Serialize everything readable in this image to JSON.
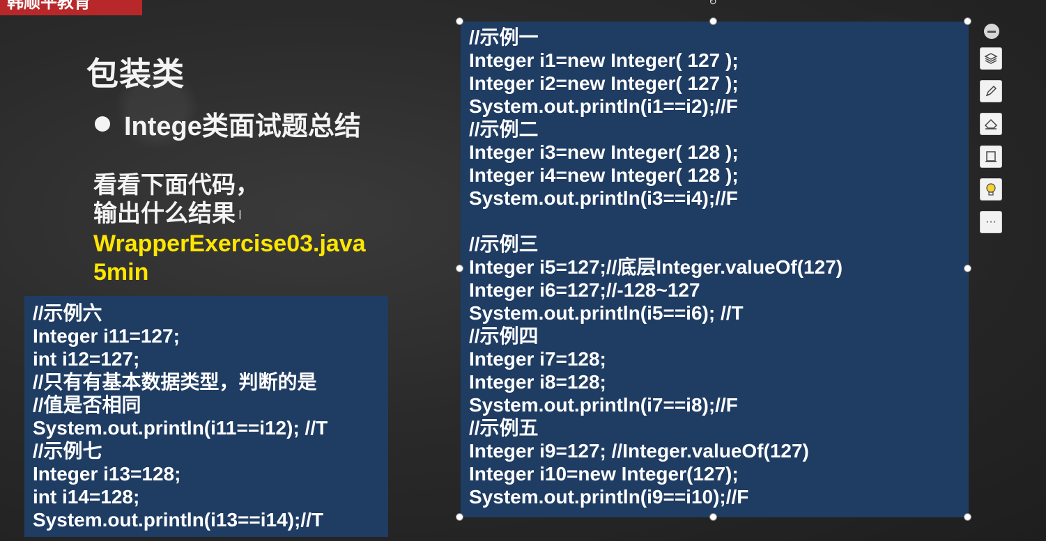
{
  "brand": {
    "label": "韩顺平教育"
  },
  "slide": {
    "title": "包装类",
    "bullet": "Intege类面试题总结",
    "prompt_lines": [
      "看看下面代码，",
      "输出什么结果"
    ],
    "file_name": "WrapperExercise03.java",
    "duration": "5min"
  },
  "code_left": {
    "lines": [
      "//示例六",
      "Integer i11=127;",
      "int i12=127;",
      "//只有有基本数据类型，判断的是",
      "//值是否相同",
      "System.out.println(i11==i12); //T",
      "//示例七",
      "Integer i13=128;",
      "int i14=128;",
      "System.out.println(i13==i14);//T"
    ]
  },
  "code_right": {
    "lines": [
      "//示例一",
      "Integer i1=new Integer( 127 );",
      "Integer i2=new Integer( 127 );",
      "System.out.println(i1==i2);//F",
      "//示例二",
      "Integer i3=new Integer( 128 );",
      "Integer i4=new Integer( 128 );",
      "System.out.println(i3==i4);//F",
      "",
      "//示例三",
      "Integer i5=127;//底层Integer.valueOf(127)",
      "Integer i6=127;//-128~127",
      "System.out.println(i5==i6); //T",
      "//示例四",
      "Integer i7=128;",
      "Integer i8=128;",
      "System.out.println(i7==i8);//F",
      "//示例五",
      "Integer i9=127; //Integer.valueOf(127)",
      "Integer i10=new Integer(127);",
      "System.out.println(i9==i10);//F"
    ]
  },
  "toolbar": {
    "items": [
      "collapse-icon",
      "layers-icon",
      "pen-icon",
      "eraser-icon",
      "frame-icon",
      "lightbulb-icon",
      "more-icon"
    ],
    "more_label": "···"
  },
  "colors": {
    "code_bg": "#1f3c63",
    "accent_yellow": "#ffe600",
    "brand_red": "#b8282a"
  }
}
